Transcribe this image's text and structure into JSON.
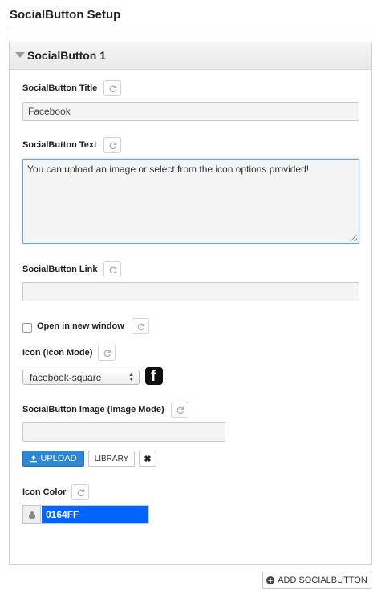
{
  "page": {
    "title": "SocialButton Setup"
  },
  "panel": {
    "title": "SocialButton 1",
    "fields": {
      "title_label": "SocialButton Title",
      "title_value": "Facebook",
      "text_label": "SocialButton Text",
      "text_value": "You can upload an image or select from the icon options provided!",
      "link_label": "SocialButton Link",
      "link_value": "",
      "new_window_label": "Open in new window",
      "new_window_checked": false,
      "icon_label": "Icon (Icon Mode)",
      "icon_value": "facebook-square",
      "image_label": "SocialButton Image (Image Mode)",
      "image_value": "",
      "upload_label": "UPLOAD",
      "library_label": "LIBRARY",
      "remove_label": "✖",
      "color_label": "Icon Color",
      "color_value": "0164FF"
    }
  },
  "footer": {
    "add_label": "ADD SOCIALBUTTON"
  },
  "colors": {
    "accent": "#0164FF",
    "upload_button": "#2F86D6",
    "focus_border": "#6CA6D8"
  },
  "icons": {
    "reset": "refresh-icon",
    "collapse": "triangle-down-icon",
    "preview": "facebook-square-icon",
    "upload": "upload-icon",
    "remove": "close-icon",
    "dropper": "drop-icon",
    "add": "plus-circle-icon"
  }
}
